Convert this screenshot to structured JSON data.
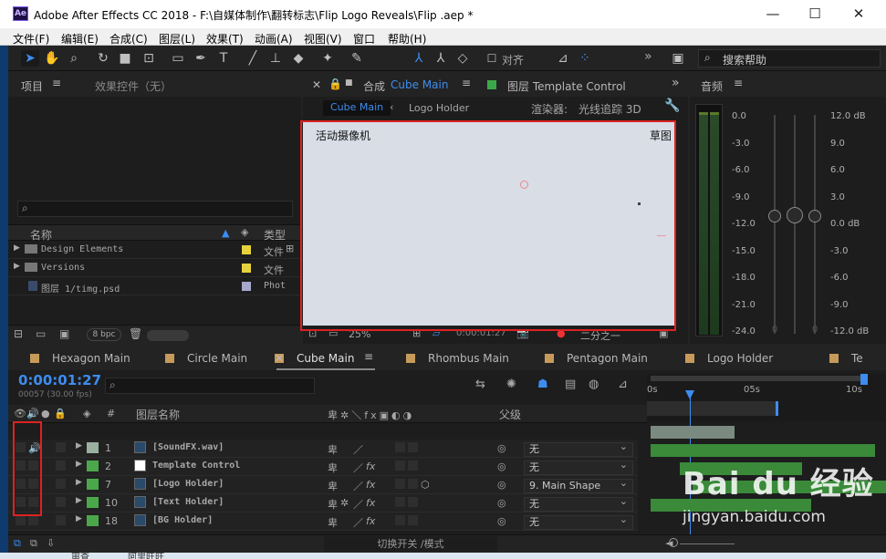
{
  "window": {
    "title": "Adobe After Effects CC 2018 - F:\\自媒体制作\\翻转标志\\Flip Logo Reveals\\Flip .aep *",
    "logo": "Ae",
    "minimize": "—",
    "maximize": "☐",
    "close": "✕"
  },
  "menu": [
    "文件(F)",
    "编辑(E)",
    "合成(C)",
    "图层(L)",
    "效果(T)",
    "动画(A)",
    "视图(V)",
    "窗口",
    "帮助(H)"
  ],
  "toolbar": {
    "align_label": "对齐",
    "search_placeholder": "搜索帮助",
    "chevron": "»"
  },
  "project": {
    "tab": "项目",
    "effects_tab": "效果控件（无）",
    "search_placeholder": "",
    "col_name": "名称",
    "col_type": "类型",
    "items": [
      {
        "name": "Design Elements",
        "type": "文件",
        "color": "#e6d23c"
      },
      {
        "name": "Versions",
        "type": "文件",
        "color": "#e6d23c"
      },
      {
        "name": "图层 1/timg.psd",
        "type": "Phot",
        "color": "#a8a8cc"
      }
    ],
    "bpc": "8 bpc"
  },
  "composition": {
    "tab_prefix": "合成",
    "tab_name": "Cube Main",
    "layer_tab": "图层 Template Control",
    "breadcrumb_active": "Cube Main",
    "breadcrumb_next": "Logo Holder",
    "renderer_label": "渲染器:",
    "renderer_value": "光线追踪 3D",
    "camera_label": "活动摄像机",
    "draft_label": "草图",
    "zoom": "25%",
    "timecode": "0:00:01:27",
    "view": "二分之一"
  },
  "audio": {
    "tab": "音频",
    "left_scale": [
      "0.0",
      "-3.0",
      "-6.0",
      "-9.0",
      "-12.0",
      "-15.0",
      "-18.0",
      "-21.0",
      "-24.0"
    ],
    "right_scale": [
      "12.0 dB",
      "9.0",
      "6.0",
      "3.0",
      "0.0 dB",
      "-3.0",
      "-6.0",
      "-9.0",
      "-12.0 dB"
    ],
    "zero_left": "0",
    "zero_right": "0"
  },
  "timeline": {
    "tabs": [
      "Hexagon Main",
      "Circle Main",
      "Cube Main",
      "Rhombus Main",
      "Pentagon Main",
      "Logo Holder",
      "Te"
    ],
    "timecode": "0:00:01:27",
    "frames": "00057 (30.00 fps)",
    "search_placeholder": "",
    "col_hash": "#",
    "col_name": "图层名称",
    "col_parent": "父级",
    "switch_mode": "切换开关 /模式",
    "ruler": [
      "0s",
      "05s",
      "10s"
    ],
    "layers": [
      {
        "num": "1",
        "name": "[SoundFX.wav]",
        "parent": "无",
        "color": "#9ab0a0",
        "bar_color": "#7a8a80"
      },
      {
        "num": "2",
        "name": "Template Control",
        "parent": "无",
        "color": "#4aa84a",
        "bar_color": "#3a8a3a"
      },
      {
        "num": "7",
        "name": "[Logo Holder]",
        "parent": "9. Main Shape",
        "color": "#4aa84a",
        "bar_color": "#3a8a3a"
      },
      {
        "num": "10",
        "name": "[Text Holder]",
        "parent": "无",
        "color": "#4aa84a",
        "bar_color": "#3a8a3a"
      },
      {
        "num": "18",
        "name": "[BG Holder]",
        "parent": "无",
        "color": "#4aa84a",
        "bar_color": "#3a8a3a"
      }
    ]
  },
  "taskbar": {
    "items": [
      "审查",
      "阿里旺旺"
    ]
  },
  "watermark": {
    "brand": "Bai du 经验",
    "url": "jingyan.baidu.com"
  }
}
